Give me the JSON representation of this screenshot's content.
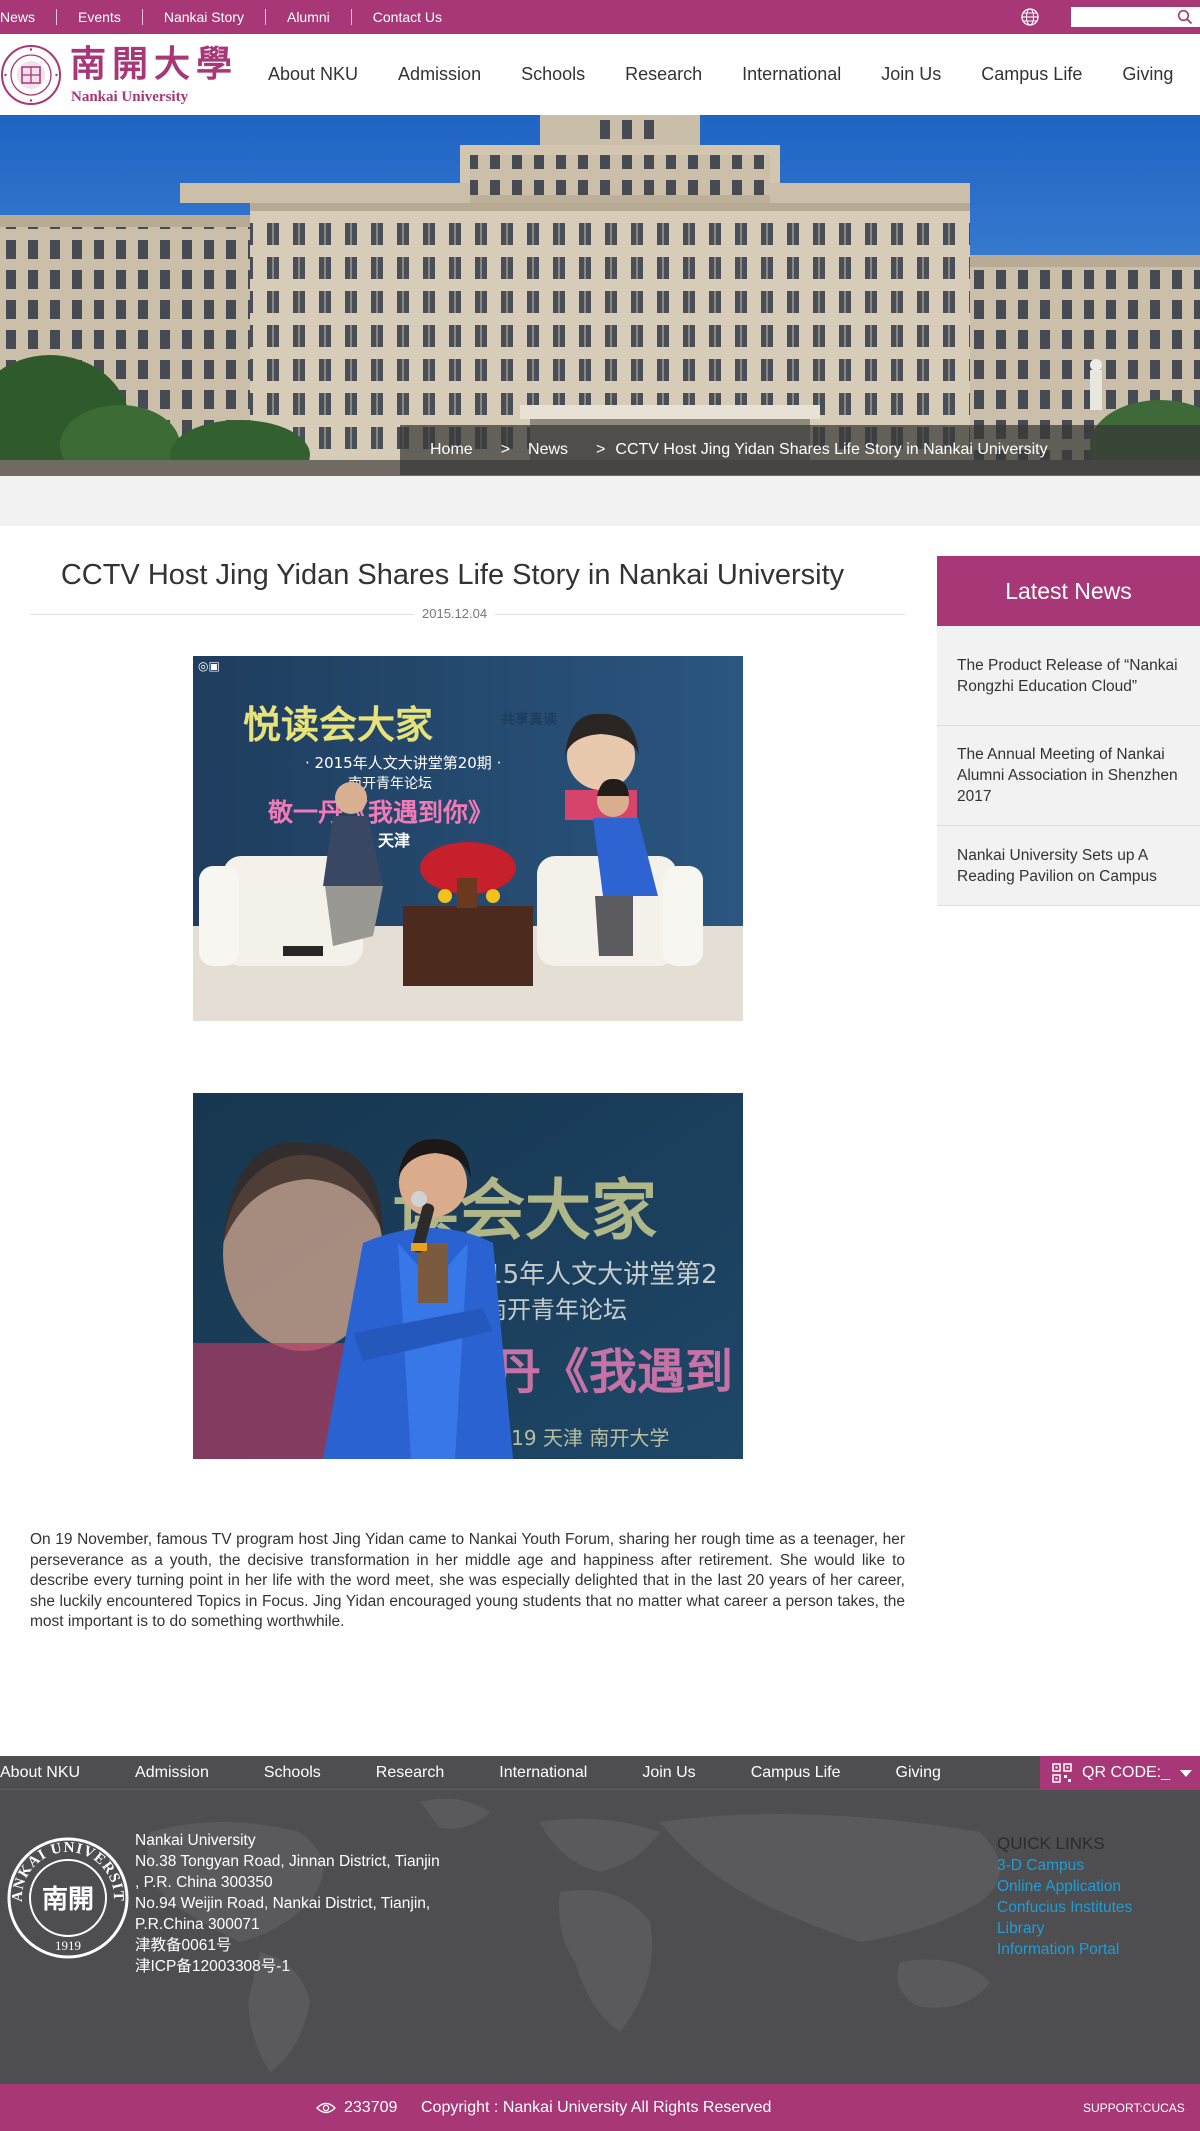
{
  "topbar": {
    "links": [
      "News",
      "Events",
      "Nankai Story",
      "Alumni",
      "Contact Us"
    ],
    "search_placeholder": ""
  },
  "brand": {
    "name_cn": "南開大學",
    "name_en": "Nankai University",
    "color": "#a73777"
  },
  "mainnav": [
    "About NKU",
    "Admission",
    "Schools",
    "Research",
    "International",
    "Join Us",
    "Campus Life",
    "Giving"
  ],
  "breadcrumb": {
    "home": "Home",
    "sep1": ">",
    "section": "News",
    "sep2": ">",
    "current": "CCTV Host Jing Yidan Shares Life Story in Nankai University"
  },
  "article": {
    "title": "CCTV Host Jing Yidan Shares Life Story in Nankai University",
    "date": "2015.12.04",
    "body": "On 19 November, famous TV program host Jing Yidan came to Nankai Youth Forum, sharing her rough time as a teenager, her perseverance as a youth, the decisive transformation in her middle age and happiness after retirement. She would like to describe every turning point in her life with the word meet, she was especially delighted that in the last 20 years of her career, she luckily encountered Topics in Focus. Jing Yidan encouraged young students that no matter what career a person takes, the most important is to do something worthwhile.",
    "photo1": {
      "banner_line1": "悦读会大家",
      "banner_tag": "共享真读",
      "banner_line2": "· 2015年人文大讲堂第20期 ·",
      "banner_line3": "南开青年论坛",
      "banner_line4": "敬一丹《我遇到你》",
      "banner_line5": "天津"
    },
    "photo2": {
      "banner_line1": "读会大家",
      "banner_line2": "2015年人文大讲堂第2",
      "banner_line3": "南开青年论坛",
      "banner_line4": "丹《我遇到",
      "banner_line5": "— 11.19 天津 南开大学"
    }
  },
  "sidebar": {
    "heading": "Latest News",
    "items": [
      "The Product Release of “Nankai Rongzhi Education Cloud”",
      "The Annual Meeting of Nankai Alumni Association in Shenzhen 2017",
      "Nankai University Sets up A Reading Pavilion on Campus"
    ]
  },
  "footer": {
    "nav": [
      "About NKU",
      "Admission",
      "Schools",
      "Research",
      "International",
      "Join Us",
      "Campus Life",
      "Giving"
    ],
    "qr_label": "QR CODE:_",
    "seal_text": "NANKAI UNIVERSITY",
    "seal_cn": "南開",
    "seal_year": "1919",
    "address": [
      "Nankai University",
      "No.38 Tongyan Road, Jinnan District, Tianjin",
      ", P.R. China 300350",
      "No.94 Weijin Road,  Nankai District, Tianjin,",
      "P.R.China  300071",
      "津教备0061号",
      "津ICP备12003308号-1"
    ],
    "quick_title": "QUICK LINKS",
    "quick_links": [
      "3-D Campus",
      "Online Application",
      "Confucius Institutes",
      "Library",
      "Information Portal"
    ]
  },
  "bottombar": {
    "visits": "233709",
    "copyright": "Copyright : Nankai University All Rights Reserved",
    "support": "SUPPORT:CUCAS"
  }
}
